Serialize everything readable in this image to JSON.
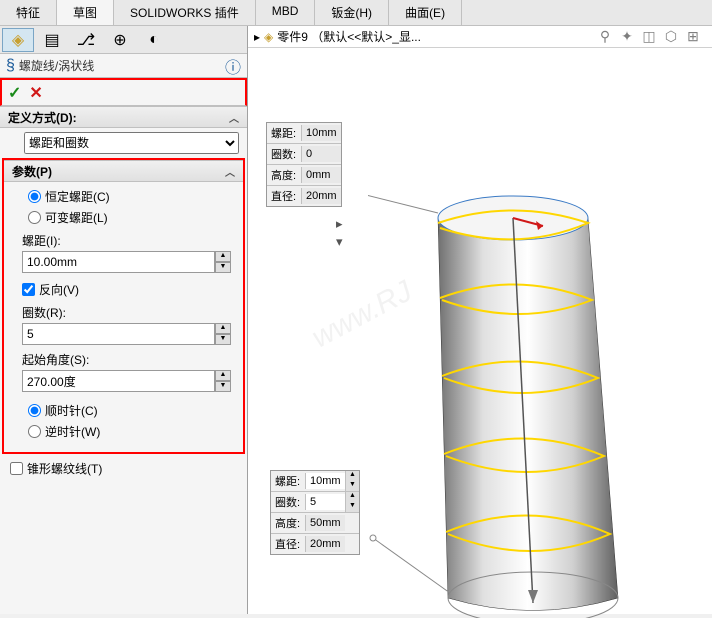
{
  "tabs": {
    "t1": "特征",
    "t2": "草图",
    "t3": "SOLIDWORKS 插件",
    "t4": "MBD",
    "t5": "钣金(H)",
    "t6": "曲面(E)"
  },
  "title": "螺旋线/涡状线",
  "sections": {
    "def_method": "定义方式(D):",
    "def_option": "螺距和圈数",
    "params": "参数(P)"
  },
  "radios": {
    "const_pitch": "恒定螺距(C)",
    "var_pitch": "可变螺距(L)",
    "cw": "顺时针(C)",
    "ccw": "逆时针(W)"
  },
  "fields": {
    "pitch_label": "螺距(I):",
    "pitch_val": "10.00mm",
    "reverse": "反向(V)",
    "rev_label": "圈数(R):",
    "rev_val": "5",
    "angle_label": "起始角度(S):",
    "angle_val": "270.00度",
    "taper": "锥形螺纹线(T)"
  },
  "breadcrumb": "零件9 （默认<<默认>_显...",
  "dim_top": {
    "l1": "螺距:",
    "v1": "10mm",
    "l2": "圈数:",
    "v2": "0",
    "l3": "高度:",
    "v3": "0mm",
    "l4": "直径:",
    "v4": "20mm"
  },
  "dim_bot": {
    "l1": "螺距:",
    "v1": "10mm",
    "l2": "圈数:",
    "v2": "5",
    "l3": "高度:",
    "v3": "50mm",
    "l4": "直径:",
    "v4": "20mm"
  }
}
